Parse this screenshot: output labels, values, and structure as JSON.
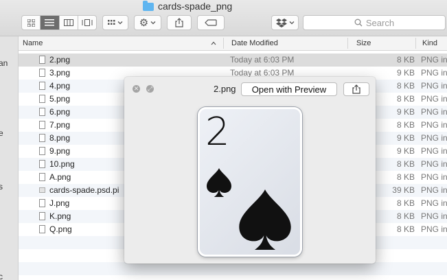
{
  "window": {
    "title": "cards-spade_png"
  },
  "toolbar": {
    "search_placeholder": "Search"
  },
  "sidebar": {
    "fragments": [
      "an",
      "e",
      "s",
      "c"
    ]
  },
  "columns": {
    "name": "Name",
    "date": "Date Modified",
    "size": "Size",
    "kind": "Kind"
  },
  "files": [
    {
      "name": "2.png",
      "date": "Today at 6:03 PM",
      "size": "8 KB",
      "kind": "PNG in"
    },
    {
      "name": "3.png",
      "date": "Today at 6:03 PM",
      "size": "9 KB",
      "kind": "PNG in"
    },
    {
      "name": "4.png",
      "date": "",
      "size": "8 KB",
      "kind": "PNG in"
    },
    {
      "name": "5.png",
      "date": "",
      "size": "8 KB",
      "kind": "PNG in"
    },
    {
      "name": "6.png",
      "date": "",
      "size": "9 KB",
      "kind": "PNG in"
    },
    {
      "name": "7.png",
      "date": "",
      "size": "8 KB",
      "kind": "PNG in"
    },
    {
      "name": "8.png",
      "date": "",
      "size": "9 KB",
      "kind": "PNG in"
    },
    {
      "name": "9.png",
      "date": "",
      "size": "9 KB",
      "kind": "PNG in"
    },
    {
      "name": "10.png",
      "date": "",
      "size": "8 KB",
      "kind": "PNG in"
    },
    {
      "name": "A.png",
      "date": "",
      "size": "8 KB",
      "kind": "PNG in"
    },
    {
      "name": "cards-spade.psd.pi",
      "date": "",
      "size": "39 KB",
      "kind": "PNG in"
    },
    {
      "name": "J.png",
      "date": "",
      "size": "8 KB",
      "kind": "PNG in"
    },
    {
      "name": "K.png",
      "date": "",
      "size": "8 KB",
      "kind": "PNG in"
    },
    {
      "name": "Q.png",
      "date": "",
      "size": "8 KB",
      "kind": "PNG in"
    }
  ],
  "quicklook": {
    "filename": "2.png",
    "open_button": "Open with Preview",
    "card_rank": "2"
  }
}
